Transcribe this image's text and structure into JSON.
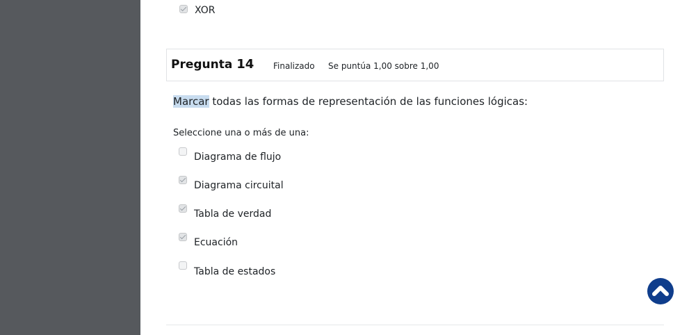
{
  "previous_question": {
    "option": {
      "label": "XOR",
      "checked": true
    }
  },
  "question": {
    "title_prefix": "Pregunta",
    "number": "14",
    "state": "Finalizado",
    "grade": "Se puntúa 1,00 sobre 1,00",
    "text_highlight": "Marcar",
    "text_rest": " todas las formas de representación de las funciones lógicas:",
    "prompt": "Seleccione una o más de una:",
    "options": [
      {
        "label": "Diagrama de flujo",
        "checked": false
      },
      {
        "label": "Diagrama circuital",
        "checked": true
      },
      {
        "label": "Tabla de verdad",
        "checked": true
      },
      {
        "label": "Ecuación",
        "checked": true
      },
      {
        "label": "Tabla de estados",
        "checked": false
      }
    ]
  },
  "back_to_top": {
    "icon": "chevron-up-icon"
  },
  "colors": {
    "sidebar": "#56595d",
    "accent": "#0f3d8c",
    "highlight": "#c8dcef"
  }
}
